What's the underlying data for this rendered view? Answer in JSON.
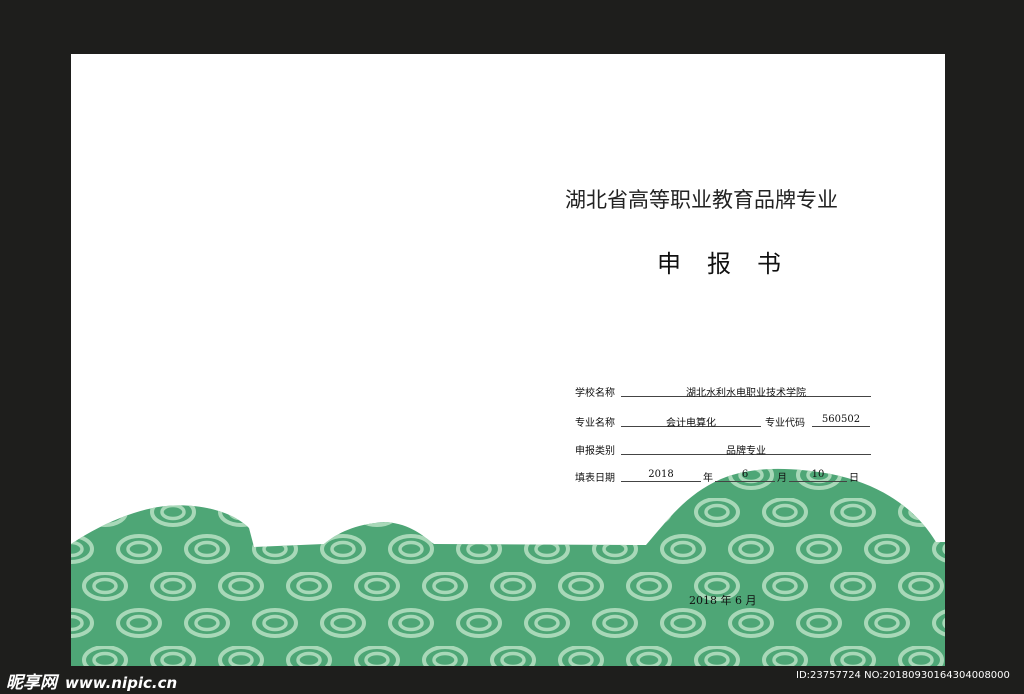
{
  "title": "湖北省高等职业教育品牌专业",
  "subtitle": "申报书",
  "fields": {
    "school_label": "学校名称",
    "school_value": "湖北水利水电职业技术学院",
    "major_label": "专业名称",
    "major_value": "会计电算化",
    "code_label": "专业代码",
    "code_value": "560502",
    "category_label": "申报类别",
    "category_value": "品牌专业",
    "date_label": "填表日期",
    "year": "2018",
    "year_unit": "年",
    "month": "6",
    "month_unit": "月",
    "day": "10",
    "day_unit": "日"
  },
  "footer_date": "2018 年 6 月",
  "watermark": {
    "logo": "昵享网",
    "url": "www.nipic.cn",
    "id_text": "ID:23757724 NO:20180930164304008000"
  },
  "colors": {
    "background": "#1e1e1c",
    "page": "#ffffff",
    "hill_green": "#4ea676",
    "circle_light": "#a8d8b8"
  }
}
